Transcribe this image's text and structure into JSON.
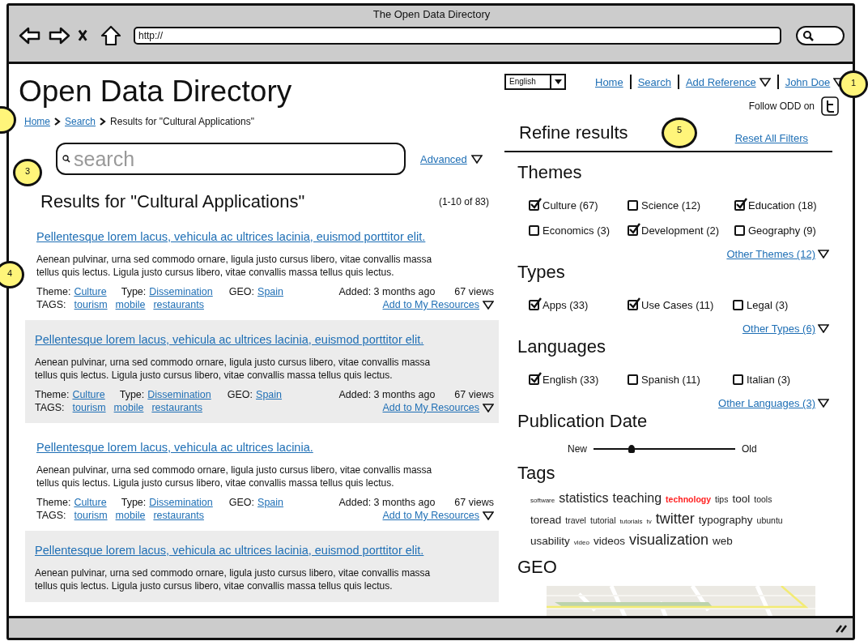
{
  "browser": {
    "title": "The Open Data Directory",
    "url": "http://"
  },
  "header": {
    "site_title": "Open Data Directory",
    "language": "English",
    "nav": [
      {
        "label": "Home",
        "kind": "link"
      },
      {
        "label": "Search",
        "kind": "link"
      },
      {
        "label": "Add Reference",
        "kind": "dropdown"
      },
      {
        "label": "John Doe",
        "kind": "dropdown"
      }
    ],
    "follow": "Follow ODD on",
    "callout": "1"
  },
  "breadcrumb": {
    "marker": true,
    "items": [
      {
        "label": "Home",
        "link": true
      },
      {
        "label": "Search",
        "link": true
      },
      {
        "label": "Results for \"Cultural Applications\"",
        "link": false
      }
    ]
  },
  "search": {
    "placeholder": "search",
    "advanced": "Advanced",
    "callout": "3"
  },
  "results_heading": "Results for \"Cultural Applications\"",
  "results_count": "(1-10 of 83)",
  "results_callout": "4",
  "results": [
    {
      "title": "Pellentesque lorem lacus, vehicula ac ultrices lacinia, euismod porttitor elit.",
      "description": "Aenean pulvinar, urna sed commodo ornare, ligula justo cursus libero, vitae convallis massa tellus quis lectus. Ligula justo cursus libero, vitae convallis massa tellus quis lectus.",
      "shaded": false,
      "meta": {
        "theme_label": "Theme:",
        "theme": "Culture",
        "type_label": "Type:",
        "type": "Dissemination",
        "geo_label": "GEO:",
        "geo": "Spain",
        "added": "Added: 3 months ago",
        "views": "67 views",
        "tags_label": "TAGS:",
        "tags": [
          "tourism",
          "mobile",
          "restaurants"
        ],
        "action": "Add to My Resources"
      }
    },
    {
      "title": "Pellentesque lorem lacus, vehicula ac ultrices lacinia, euismod porttitor elit.",
      "description": "Aenean pulvinar, urna sed commodo ornare, ligula justo cursus libero, vitae convallis massa tellus quis lectus. Ligula justo cursus libero, vitae convallis massa tellus quis lectus.",
      "shaded": true,
      "meta": {
        "theme_label": "Theme:",
        "theme": "Culture",
        "type_label": "Type:",
        "type": "Dissemination",
        "geo_label": "GEO:",
        "geo": "Spain",
        "added": "Added: 3 months ago",
        "views": "67 views",
        "tags_label": "TAGS:",
        "tags": [
          "tourism",
          "mobile",
          "restaurants"
        ],
        "action": "Add to My Resources"
      }
    },
    {
      "title": "Pellentesque lorem lacus, vehicula ac ultrices lacinia.",
      "description": "Aenean pulvinar, urna sed commodo ornare, ligula justo cursus libero, vitae convallis massa tellus quis lectus. Ligula justo cursus libero, vitae convallis massa tellus quis lectus.",
      "shaded": false,
      "meta": {
        "theme_label": "Theme:",
        "theme": "Culture",
        "type_label": "Type:",
        "type": "Dissemination",
        "geo_label": "GEO:",
        "geo": "Spain",
        "added": "Added: 3 months ago",
        "views": "67 views",
        "tags_label": "TAGS:",
        "tags": [
          "tourism",
          "mobile",
          "restaurants"
        ],
        "action": "Add to My Resources"
      }
    },
    {
      "title": "Pellentesque lorem lacus, vehicula ac ultrices lacinia, euismod porttitor elit.",
      "description": "Aenean pulvinar, urna sed commodo ornare, ligula justo cursus libero, vitae convallis massa tellus quis lectus. Ligula justo cursus libero, vitae convallis massa tellus quis lectus.",
      "shaded": true
    }
  ],
  "refine": {
    "title": "Refine results",
    "reset": "Reset All Filters",
    "callout": "5",
    "groups": [
      {
        "title": "Themes",
        "options": [
          {
            "label": "Culture (67)",
            "checked": true
          },
          {
            "label": "Science (12)",
            "checked": false
          },
          {
            "label": "Education (18)",
            "checked": true
          },
          {
            "label": "Economics (3)",
            "checked": false
          },
          {
            "label": "Development (2)",
            "checked": true
          },
          {
            "label": "Geography (9)",
            "checked": false
          }
        ],
        "more": "Other Themes (12)"
      },
      {
        "title": "Types",
        "options": [
          {
            "label": "Apps (33)",
            "checked": true
          },
          {
            "label": "Use Cases (11)",
            "checked": true
          },
          {
            "label": "Legal (3)",
            "checked": false
          }
        ],
        "more": "Other Types (6)"
      },
      {
        "title": "Languages",
        "options": [
          {
            "label": "English (33)",
            "checked": true
          },
          {
            "label": "Spanish (11)",
            "checked": false
          },
          {
            "label": "Italian (3)",
            "checked": false
          }
        ],
        "more": "Other Languages (3)"
      }
    ]
  },
  "publication": {
    "title": "Publication Date",
    "from": "New",
    "to": "Old",
    "level": 0.27
  },
  "tags": {
    "title": "Tags",
    "items": [
      {
        "label": "software",
        "kind": "tiny"
      },
      {
        "label": "statistics",
        "kind": "large"
      },
      {
        "label": "teaching",
        "kind": "large"
      },
      {
        "label": "technology",
        "kind": "small",
        "color": "#ff2020"
      },
      {
        "label": "tips",
        "kind": "small"
      },
      {
        "label": "tool",
        "kind": "medium"
      },
      {
        "label": "tools",
        "kind": "small"
      },
      {
        "label": "toread",
        "kind": "medium"
      },
      {
        "label": "travel",
        "kind": "small"
      },
      {
        "label": "tutorial",
        "kind": "small"
      },
      {
        "label": "tutorials",
        "kind": "tiny"
      },
      {
        "label": "tv",
        "kind": "micro"
      },
      {
        "label": "twitter",
        "kind": "huge"
      },
      {
        "label": "typography",
        "kind": "medium"
      },
      {
        "label": "ubuntu",
        "kind": "small"
      },
      {
        "label": "usability",
        "kind": "medium"
      },
      {
        "label": "video",
        "kind": "micro"
      },
      {
        "label": "videos",
        "kind": "medium"
      },
      {
        "label": "visualization",
        "kind": "huge"
      },
      {
        "label": "web",
        "kind": "medium"
      }
    ]
  },
  "geo": {
    "title": "GEO"
  }
}
